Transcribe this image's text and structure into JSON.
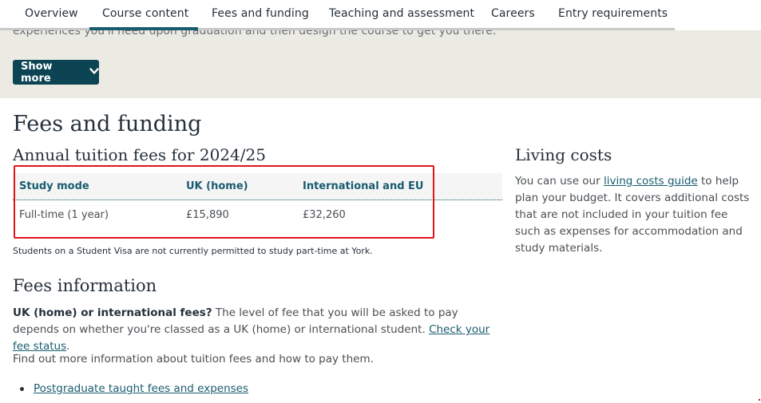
{
  "tabs": [
    {
      "label": "Overview"
    },
    {
      "label": "Course content"
    },
    {
      "label": "Fees and funding"
    },
    {
      "label": "Teaching and assessment"
    },
    {
      "label": "Careers"
    },
    {
      "label": "Entry requirements"
    }
  ],
  "active_tab": "Course content",
  "band": {
    "cut_text": "experiences you'll need upon graduation and then design the course to get you there.",
    "show_more_label": "Show more",
    "show_more_icon": "chevron-down-icon"
  },
  "fees": {
    "heading": "Fees and funding",
    "annual_heading": "Annual tuition fees for 2024/25",
    "table": {
      "headers": [
        "Study mode",
        "UK (home)",
        "International and EU"
      ],
      "rows": [
        [
          "Full-time (1 year)",
          "£15,890",
          "£32,260"
        ]
      ]
    },
    "note": "Students on a Student Visa are not currently permitted to study part-time at York."
  },
  "fees_info": {
    "heading": "Fees information",
    "lead_bold": "UK (home) or international fees?",
    "lead_text": " The level of fee that you will be asked to pay depends on whether you're classed as a UK (home) or international student. ",
    "lead_link": "Check your fee status",
    "lead_end": ".",
    "more_text": "Find out more information about tuition fees and how to pay them.",
    "links": [
      "Postgraduate taught fees and expenses"
    ]
  },
  "living": {
    "heading": "Living costs",
    "text_before": "You can use our ",
    "link": "living costs guide",
    "text_after": " to help plan your budget. It covers additional costs that are not included in your tuition fee such as expenses for accommodation and study materials."
  },
  "colors": {
    "accent": "#195c6f",
    "button": "#0d4454",
    "band": "#ebebe3",
    "highlight": "#e1141c"
  }
}
